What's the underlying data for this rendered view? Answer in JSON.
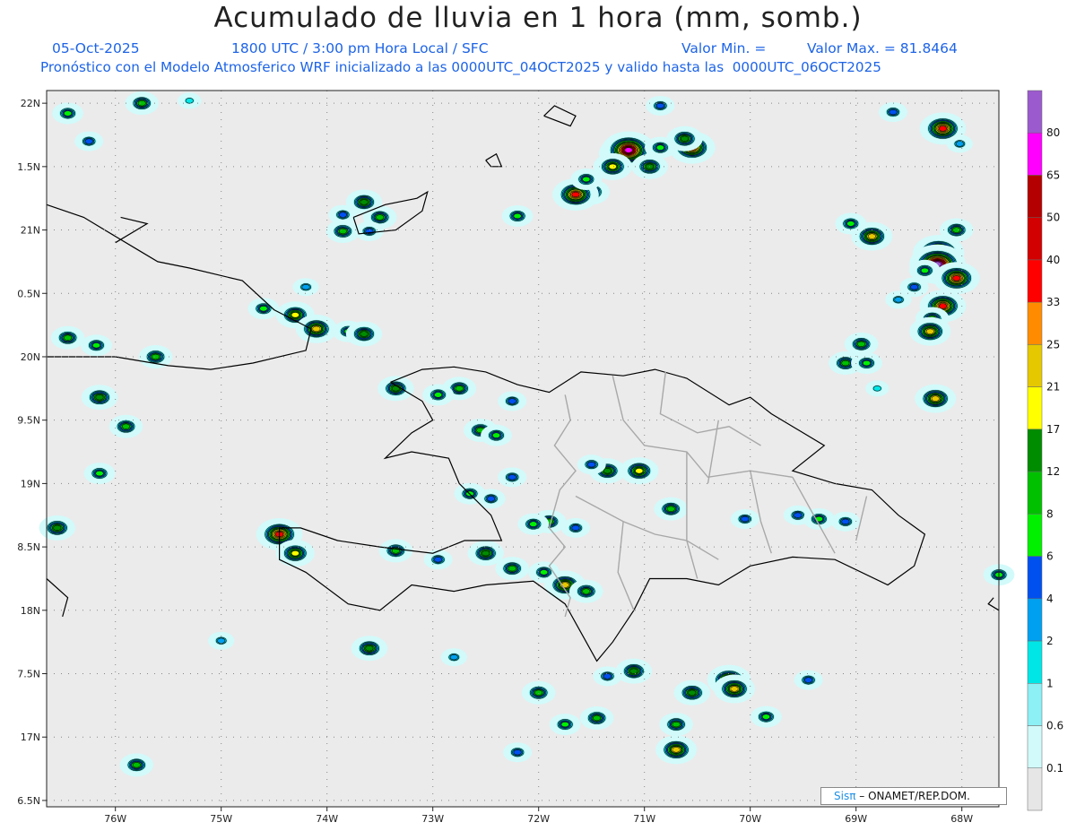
{
  "header": {
    "title": "Acumulado de lluvia en 1 hora (mm, somb.)",
    "date": "05-Oct-2025",
    "time": "1800 UTC / 3:00 pm Hora Local / SFC",
    "vmin": "Valor Min. =",
    "vmax": "Valor Max. = 81.8464",
    "model": "Pronóstico con el Modelo Atmosferico WRF inicializado a las 0000UTC_04OCT2025 y valido hasta las  0000UTC_06OCT2025"
  },
  "credit": {
    "sis": "Sisπ",
    "text": " – ONAMET/REP.DOM."
  },
  "colors": {
    "map_bg": "#ebebeb",
    "coast": "#000000",
    "provinces": "#a8a8a8",
    "grid_dots": "#888888"
  },
  "chart_data": {
    "type": "heatmap",
    "xlabels": [
      "76W",
      "75W",
      "74W",
      "73W",
      "72W",
      "71W",
      "70W",
      "69W",
      "68W"
    ],
    "xvalues": [
      -76,
      -75,
      -74,
      -73,
      -72,
      -71,
      -70,
      -69,
      -68
    ],
    "ylabels": [
      "22N",
      "1.5N",
      "21N",
      "0.5N",
      "20N",
      "9.5N",
      "19N",
      "8.5N",
      "18N",
      "7.5N",
      "17N",
      "6.5N"
    ],
    "yvalues": [
      22,
      21.5,
      21,
      20.5,
      20,
      19.5,
      19,
      18.5,
      18,
      17.5,
      17,
      16.5
    ],
    "xlim": [
      -76.65,
      -67.65
    ],
    "ylim": [
      16.45,
      22.1
    ],
    "colorbar": {
      "labels": [
        "0.1",
        "0.6",
        "1",
        "2",
        "4",
        "6",
        "8",
        "12",
        "17",
        "21",
        "25",
        "33",
        "40",
        "50",
        "65",
        "80"
      ],
      "colors": [
        "#e6e6e6",
        "#d2fafa",
        "#8cf0f5",
        "#00e6e6",
        "#00a0f0",
        "#0050f0",
        "#00f000",
        "#00c000",
        "#008c00",
        "#ffff00",
        "#e6c800",
        "#ff8c00",
        "#ff0000",
        "#d20000",
        "#b40000",
        "#ff00ff",
        "#9b5acd"
      ]
    },
    "value_range": {
      "max": 81.8464
    },
    "cells": [
      {
        "lon": -76.45,
        "lat": 21.92,
        "v": 6
      },
      {
        "lon": -76.25,
        "lat": 21.7,
        "v": 4
      },
      {
        "lon": -75.75,
        "lat": 22.0,
        "v": 8
      },
      {
        "lon": -75.3,
        "lat": 22.02,
        "v": 1
      },
      {
        "lon": -73.65,
        "lat": 21.22,
        "v": 12
      },
      {
        "lon": -73.5,
        "lat": 21.1,
        "v": 8
      },
      {
        "lon": -73.85,
        "lat": 21.12,
        "v": 4
      },
      {
        "lon": -73.85,
        "lat": 20.99,
        "v": 8
      },
      {
        "lon": -73.6,
        "lat": 20.99,
        "v": 4
      },
      {
        "lon": -72.2,
        "lat": 21.11,
        "v": 6
      },
      {
        "lon": -71.2,
        "lat": 21.6,
        "v": 40
      },
      {
        "lon": -71.15,
        "lat": 21.63,
        "v": 65
      },
      {
        "lon": -71.3,
        "lat": 21.5,
        "v": 17
      },
      {
        "lon": -71.5,
        "lat": 21.3,
        "v": 12
      },
      {
        "lon": -71.65,
        "lat": 21.28,
        "v": 33
      },
      {
        "lon": -70.95,
        "lat": 21.5,
        "v": 12
      },
      {
        "lon": -70.85,
        "lat": 21.65,
        "v": 6
      },
      {
        "lon": -70.55,
        "lat": 21.65,
        "v": 33
      },
      {
        "lon": -70.62,
        "lat": 21.72,
        "v": 12
      },
      {
        "lon": -70.85,
        "lat": 21.98,
        "v": 4
      },
      {
        "lon": -71.55,
        "lat": 21.4,
        "v": 6
      },
      {
        "lon": -68.65,
        "lat": 21.93,
        "v": 4
      },
      {
        "lon": -68.18,
        "lat": 21.8,
        "v": 33
      },
      {
        "lon": -68.02,
        "lat": 21.68,
        "v": 2
      },
      {
        "lon": -68.22,
        "lat": 20.82,
        "v": 50
      },
      {
        "lon": -68.23,
        "lat": 20.73,
        "v": 80
      },
      {
        "lon": -68.05,
        "lat": 20.62,
        "v": 33
      },
      {
        "lon": -68.18,
        "lat": 20.4,
        "v": 33
      },
      {
        "lon": -68.35,
        "lat": 20.68,
        "v": 6
      },
      {
        "lon": -68.45,
        "lat": 20.55,
        "v": 4
      },
      {
        "lon": -68.05,
        "lat": 21.0,
        "v": 8
      },
      {
        "lon": -68.28,
        "lat": 20.3,
        "v": 8
      },
      {
        "lon": -68.3,
        "lat": 20.2,
        "v": 21
      },
      {
        "lon": -68.6,
        "lat": 20.45,
        "v": 2
      },
      {
        "lon": -68.85,
        "lat": 20.95,
        "v": 21
      },
      {
        "lon": -69.05,
        "lat": 21.05,
        "v": 6
      },
      {
        "lon": -68.95,
        "lat": 20.1,
        "v": 8
      },
      {
        "lon": -69.1,
        "lat": 19.95,
        "v": 8
      },
      {
        "lon": -68.9,
        "lat": 19.95,
        "v": 6
      },
      {
        "lon": -68.25,
        "lat": 19.67,
        "v": 21
      },
      {
        "lon": -74.3,
        "lat": 20.33,
        "v": 17
      },
      {
        "lon": -74.1,
        "lat": 20.22,
        "v": 21
      },
      {
        "lon": -73.8,
        "lat": 20.2,
        "v": 6
      },
      {
        "lon": -73.65,
        "lat": 20.18,
        "v": 12
      },
      {
        "lon": -74.6,
        "lat": 20.38,
        "v": 6
      },
      {
        "lon": -76.45,
        "lat": 20.15,
        "v": 8
      },
      {
        "lon": -76.18,
        "lat": 20.09,
        "v": 6
      },
      {
        "lon": -75.62,
        "lat": 20.0,
        "v": 8
      },
      {
        "lon": -76.15,
        "lat": 19.68,
        "v": 12
      },
      {
        "lon": -75.9,
        "lat": 19.45,
        "v": 8
      },
      {
        "lon": -76.15,
        "lat": 19.08,
        "v": 6
      },
      {
        "lon": -76.55,
        "lat": 18.65,
        "v": 12
      },
      {
        "lon": -74.45,
        "lat": 18.6,
        "v": 33
      },
      {
        "lon": -74.3,
        "lat": 18.45,
        "v": 17
      },
      {
        "lon": -73.35,
        "lat": 18.47,
        "v": 8
      },
      {
        "lon": -72.95,
        "lat": 18.4,
        "v": 4
      },
      {
        "lon": -72.5,
        "lat": 18.45,
        "v": 12
      },
      {
        "lon": -72.25,
        "lat": 18.33,
        "v": 8
      },
      {
        "lon": -71.95,
        "lat": 18.3,
        "v": 6
      },
      {
        "lon": -71.75,
        "lat": 18.2,
        "v": 21
      },
      {
        "lon": -71.55,
        "lat": 18.15,
        "v": 8
      },
      {
        "lon": -71.9,
        "lat": 18.7,
        "v": 8
      },
      {
        "lon": -72.05,
        "lat": 18.68,
        "v": 6
      },
      {
        "lon": -71.65,
        "lat": 18.65,
        "v": 4
      },
      {
        "lon": -71.35,
        "lat": 19.1,
        "v": 12
      },
      {
        "lon": -71.05,
        "lat": 19.1,
        "v": 17
      },
      {
        "lon": -71.5,
        "lat": 19.15,
        "v": 4
      },
      {
        "lon": -70.75,
        "lat": 18.8,
        "v": 8
      },
      {
        "lon": -70.05,
        "lat": 18.72,
        "v": 4
      },
      {
        "lon": -69.55,
        "lat": 18.75,
        "v": 4
      },
      {
        "lon": -69.35,
        "lat": 18.72,
        "v": 6
      },
      {
        "lon": -69.1,
        "lat": 18.7,
        "v": 4
      },
      {
        "lon": -72.75,
        "lat": 19.75,
        "v": 8
      },
      {
        "lon": -72.95,
        "lat": 19.7,
        "v": 6
      },
      {
        "lon": -73.35,
        "lat": 19.75,
        "v": 12
      },
      {
        "lon": -72.55,
        "lat": 19.42,
        "v": 8
      },
      {
        "lon": -72.4,
        "lat": 19.38,
        "v": 6
      },
      {
        "lon": -72.25,
        "lat": 19.05,
        "v": 4
      },
      {
        "lon": -72.65,
        "lat": 18.92,
        "v": 6
      },
      {
        "lon": -72.45,
        "lat": 18.88,
        "v": 4
      },
      {
        "lon": -73.6,
        "lat": 17.7,
        "v": 12
      },
      {
        "lon": -72.8,
        "lat": 17.63,
        "v": 2
      },
      {
        "lon": -72.0,
        "lat": 17.35,
        "v": 8
      },
      {
        "lon": -71.1,
        "lat": 17.52,
        "v": 12
      },
      {
        "lon": -70.2,
        "lat": 17.45,
        "v": 25
      },
      {
        "lon": -70.15,
        "lat": 17.38,
        "v": 21
      },
      {
        "lon": -70.55,
        "lat": 17.35,
        "v": 12
      },
      {
        "lon": -70.7,
        "lat": 17.1,
        "v": 8
      },
      {
        "lon": -70.7,
        "lat": 16.9,
        "v": 21
      },
      {
        "lon": -71.45,
        "lat": 17.15,
        "v": 8
      },
      {
        "lon": -71.75,
        "lat": 17.1,
        "v": 6
      },
      {
        "lon": -69.85,
        "lat": 17.16,
        "v": 6
      },
      {
        "lon": -69.45,
        "lat": 17.45,
        "v": 4
      },
      {
        "lon": -72.2,
        "lat": 16.88,
        "v": 4
      },
      {
        "lon": -75.8,
        "lat": 16.78,
        "v": 8
      },
      {
        "lon": -71.35,
        "lat": 17.48,
        "v": 4
      },
      {
        "lon": -67.65,
        "lat": 18.28,
        "v": 6
      },
      {
        "lon": -75.0,
        "lat": 17.76,
        "v": 2
      },
      {
        "lon": -72.25,
        "lat": 19.65,
        "v": 4
      },
      {
        "lon": -68.8,
        "lat": 19.75,
        "v": 1
      },
      {
        "lon": -74.2,
        "lat": 20.55,
        "v": 2
      }
    ]
  }
}
